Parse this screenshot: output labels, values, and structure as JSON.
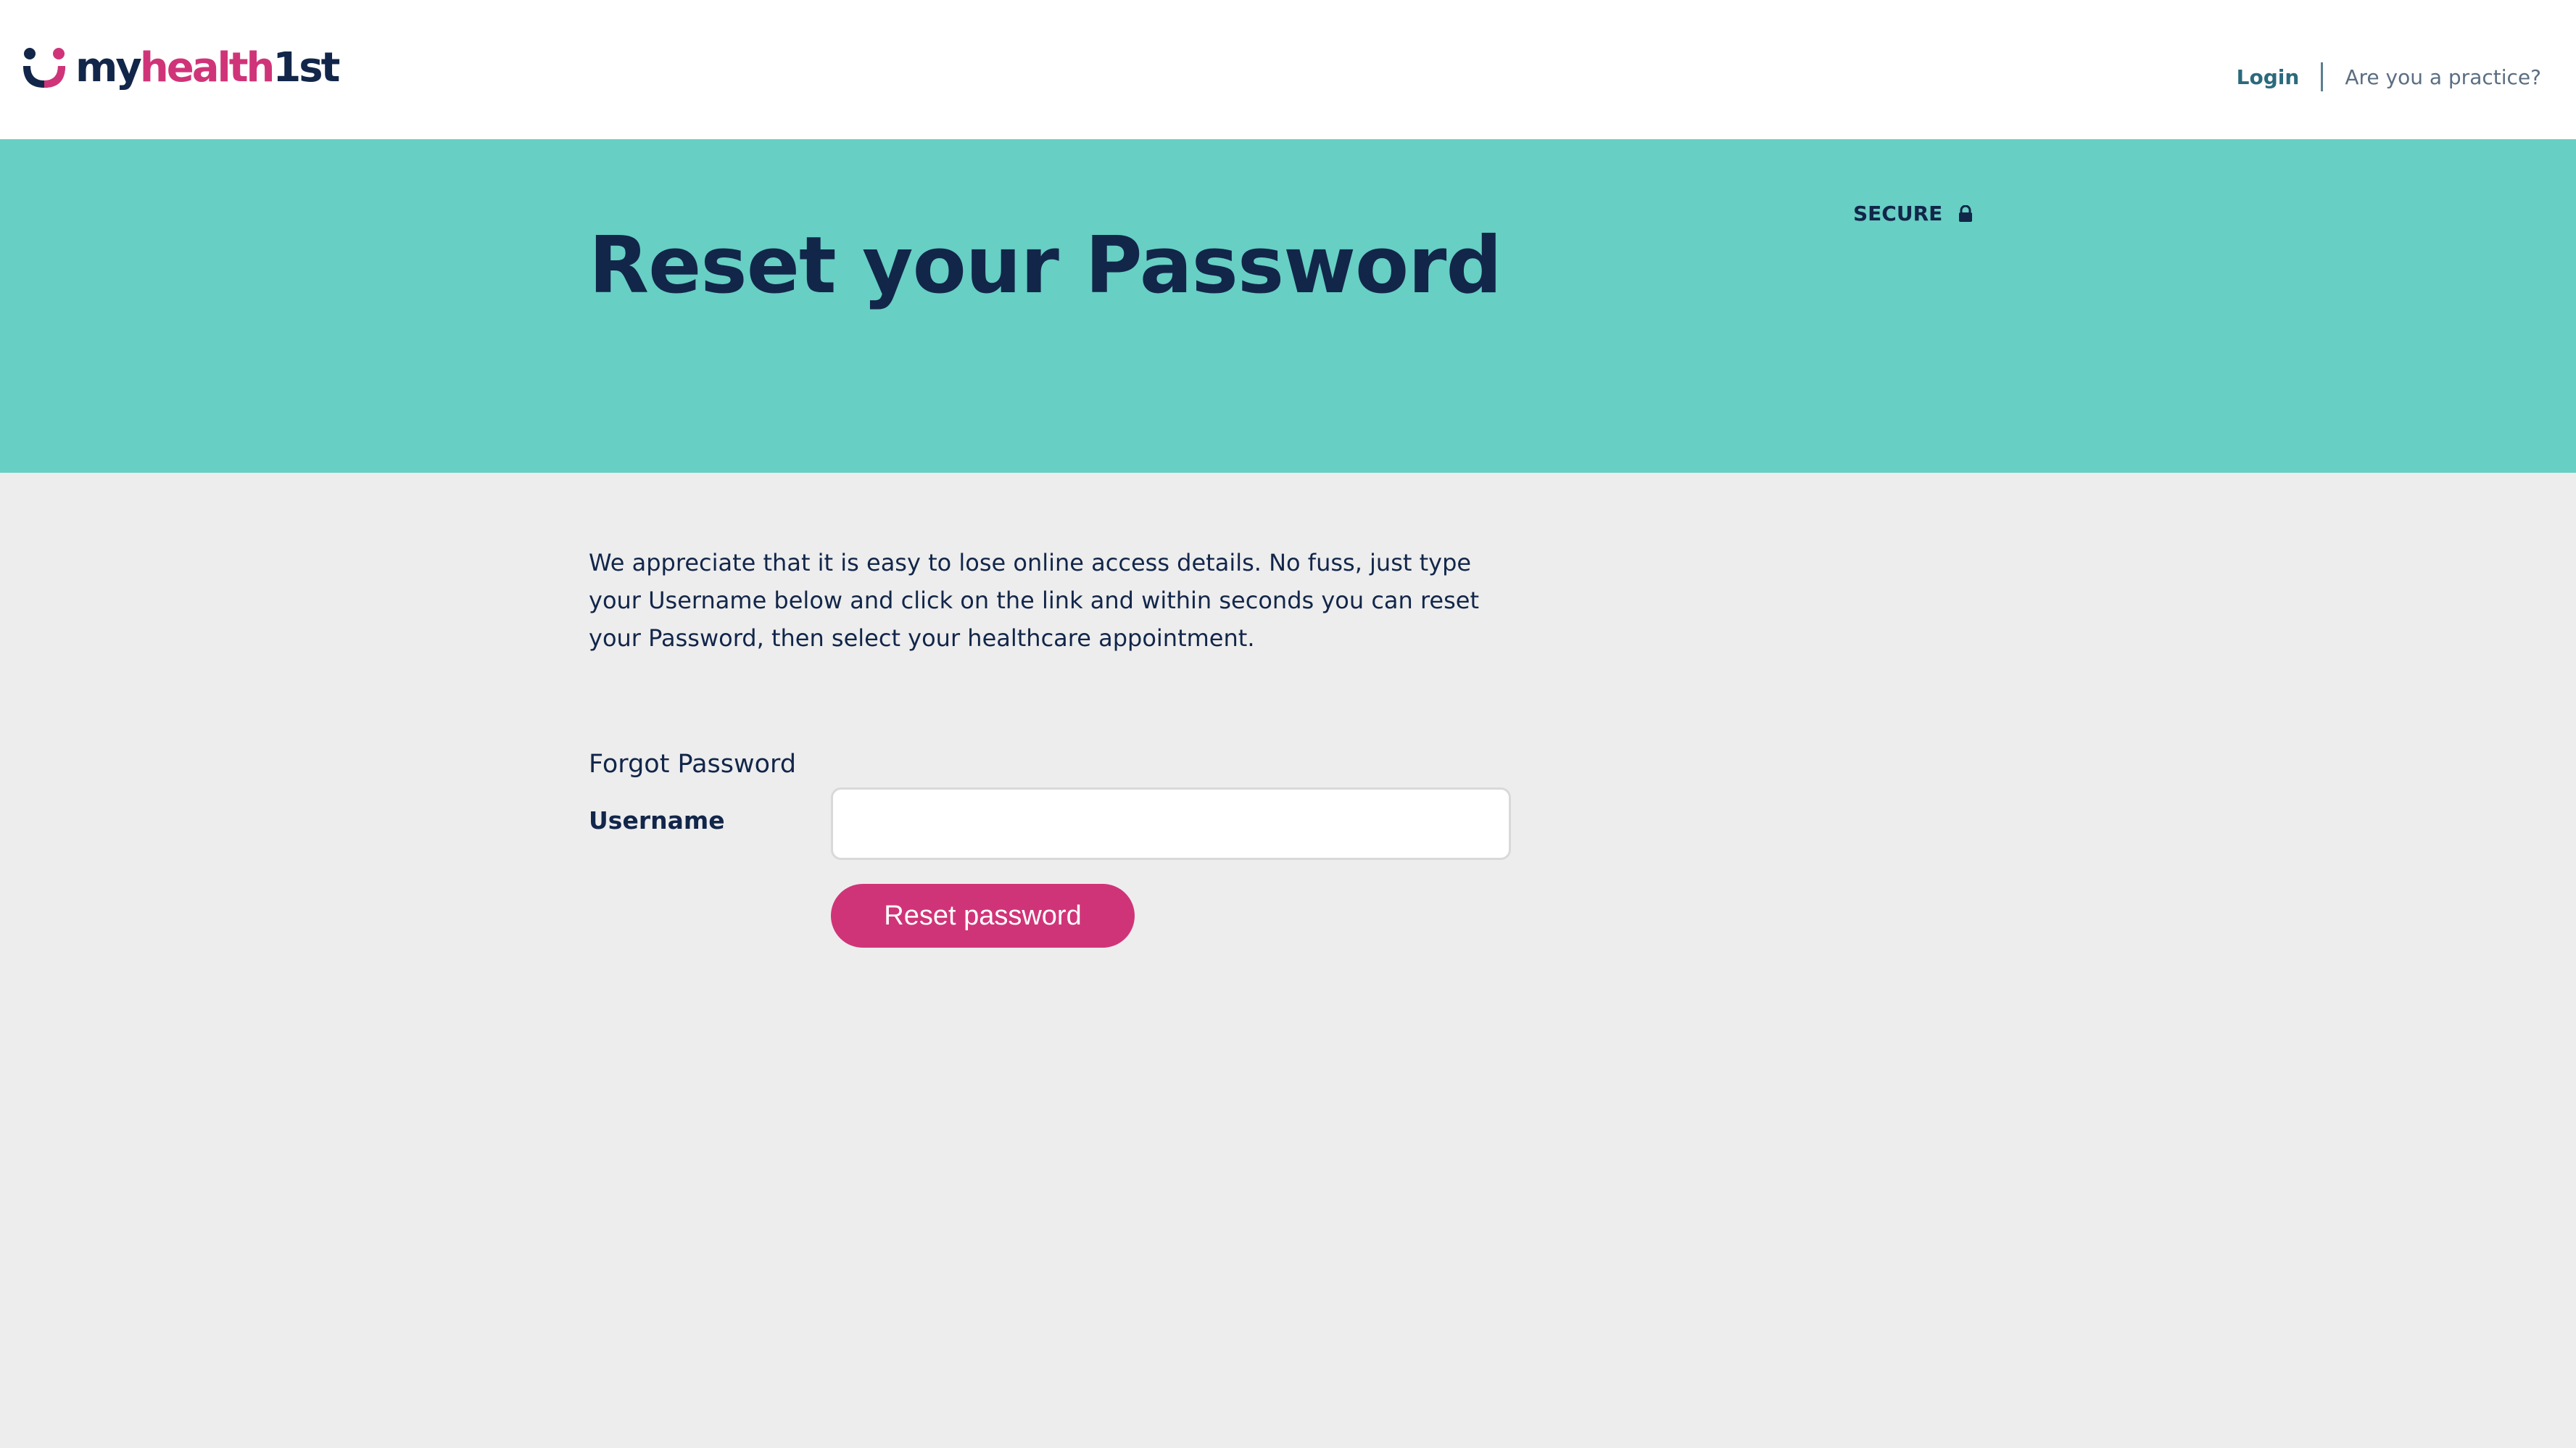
{
  "header": {
    "logo": {
      "part_my": "my",
      "part_health": "health",
      "part_first": "1st"
    },
    "nav": {
      "login_label": "Login",
      "practice_label": "Are you a practice?"
    }
  },
  "banner": {
    "title": "Reset your Password",
    "secure_label": "SECURE",
    "secure_icon": "lock-icon"
  },
  "content": {
    "intro_text": "We appreciate that it is easy to lose online access details. No fuss, just type your Username below and click on the link and within seconds you can reset your Password, then select your healthcare appointment.",
    "form": {
      "heading": "Forgot Password",
      "username_label": "Username",
      "username_value": "",
      "submit_label": "Reset password"
    }
  },
  "colors": {
    "brand_navy": "#12264a",
    "brand_pink": "#d03478",
    "banner_teal": "#67cfc3",
    "page_background": "#ededed",
    "login_link": "#2b6a7c"
  }
}
